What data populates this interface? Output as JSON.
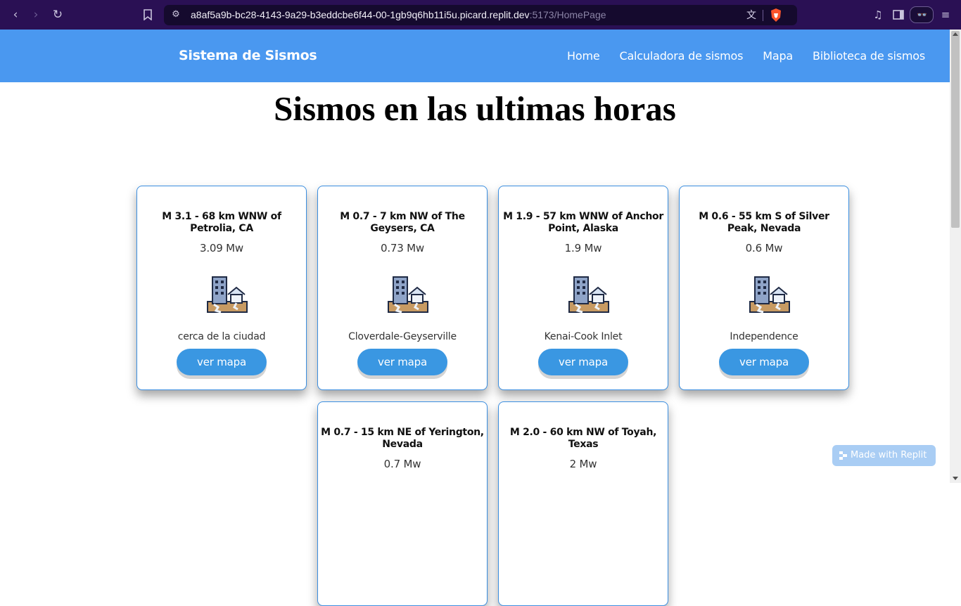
{
  "browser": {
    "url_main": "a8af5a9b-bc28-4143-9a29-b3eddcbe6f44-00-1gb9q6hb11i5u.picard.replit.dev",
    "url_dim": ":5173/HomePage",
    "glasses_label": "👓"
  },
  "navbar": {
    "brand": "Sistema de Sismos",
    "links": [
      "Home",
      "Calculadora de sismos",
      "Mapa",
      "Biblioteca de sismos"
    ]
  },
  "main": {
    "title": "Sismos en las ultimas horas"
  },
  "cards": [
    {
      "title": "M 3.1 - 68 km WNW of Petrolia, CA",
      "magnitude": "3.09 Mw",
      "place": "cerca de la ciudad",
      "button": "ver mapa"
    },
    {
      "title": "M 0.7 - 7 km NW of The Geysers, CA",
      "magnitude": "0.73 Mw",
      "place": "Cloverdale-Geyserville",
      "button": "ver mapa"
    },
    {
      "title": "M 1.9 - 57 km WNW of Anchor Point, Alaska",
      "magnitude": "1.9 Mw",
      "place": "Kenai-Cook Inlet",
      "button": "ver mapa"
    },
    {
      "title": "M 0.6 - 55 km S of Silver Peak, Nevada",
      "magnitude": "0.6 Mw",
      "place": "Independence",
      "button": "ver mapa"
    },
    {
      "title": "M 0.7 - 15 km NE of Yerington, Nevada",
      "magnitude": "0.7 Mw",
      "place": "",
      "button": ""
    },
    {
      "title": "M 2.0 - 60 km NW of Toyah, Texas",
      "magnitude": "2 Mw",
      "place": "",
      "button": ""
    }
  ],
  "badge": {
    "label": "Made with Replit"
  },
  "colors": {
    "navbar": "#4a98f0",
    "button": "#3a97e2",
    "card_border": "#3b8ee0",
    "browser_chrome": "#2a1054"
  }
}
